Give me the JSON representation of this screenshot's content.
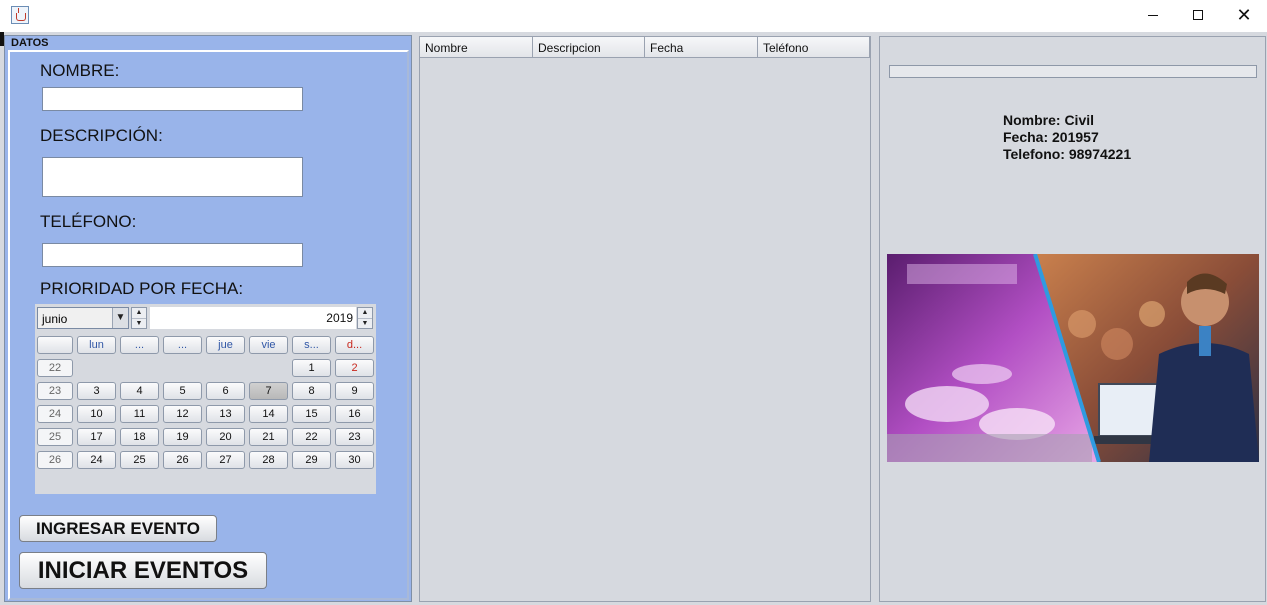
{
  "window": {
    "icon": "java-cup-icon"
  },
  "datos": {
    "title": "DATOS",
    "labels": {
      "nombre": "NOMBRE:",
      "descripcion": "DESCRIPCIÓN:",
      "telefono": "TELÉFONO:",
      "prioridad": "PRIORIDAD POR FECHA:"
    },
    "fields": {
      "nombre": "",
      "descripcion": "",
      "telefono": ""
    }
  },
  "calendar": {
    "month": "junio",
    "year": "2019",
    "day_headers": [
      "",
      "lun",
      "...",
      "...",
      "jue",
      "vie",
      "s...",
      "d..."
    ],
    "weeks": [
      {
        "week": "22",
        "days": [
          "",
          "",
          "",
          "",
          "",
          "1",
          "2"
        ]
      },
      {
        "week": "23",
        "days": [
          "3",
          "4",
          "5",
          "6",
          "7",
          "8",
          "9"
        ]
      },
      {
        "week": "24",
        "days": [
          "10",
          "11",
          "12",
          "13",
          "14",
          "15",
          "16"
        ]
      },
      {
        "week": "25",
        "days": [
          "17",
          "18",
          "19",
          "20",
          "21",
          "22",
          "23"
        ]
      },
      {
        "week": "26",
        "days": [
          "24",
          "25",
          "26",
          "27",
          "28",
          "29",
          "30"
        ]
      }
    ],
    "selected_day": "7"
  },
  "buttons": {
    "ingresar": "INGRESAR EVENTO",
    "iniciar": "INICIAR EVENTOS"
  },
  "table": {
    "columns": [
      "Nombre",
      "Descripcion",
      "Fecha",
      "Teléfono"
    ]
  },
  "event_info": {
    "nombre": "Nombre: Civil",
    "fecha": "Fecha: 201957",
    "telefono": "Telefono: 98974221"
  },
  "progress": 0
}
